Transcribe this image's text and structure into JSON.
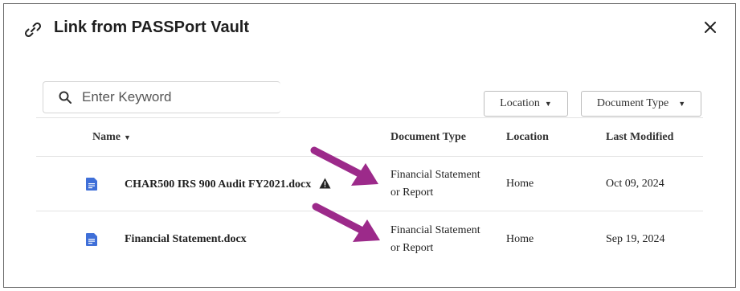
{
  "dialog": {
    "title": "Link from PASSPort Vault",
    "title_icon": "link-icon",
    "close_icon": "close-icon"
  },
  "search": {
    "placeholder": "Enter Keyword",
    "value": "",
    "icon": "search-icon"
  },
  "filters": {
    "location_label": "Location",
    "doctype_label": "Document Type"
  },
  "table": {
    "headers": {
      "name": "Name",
      "doctype": "Document Type",
      "location": "Location",
      "modified": "Last Modified"
    },
    "rows": [
      {
        "name": "CHAR500 IRS 900 Audit FY2021.docx",
        "warning": true,
        "doctype_line1": "Financial Statement",
        "doctype_line2": "or Report",
        "location": "Home",
        "modified": "Oct 09, 2024"
      },
      {
        "name": "Financial Statement.docx",
        "warning": false,
        "doctype_line1": "Financial Statement",
        "doctype_line2": "or Report",
        "location": "Home",
        "modified": "Sep 19, 2024"
      }
    ]
  },
  "colors": {
    "arrow": "#9c2a8a",
    "doc_icon": "#3f6fd8"
  }
}
